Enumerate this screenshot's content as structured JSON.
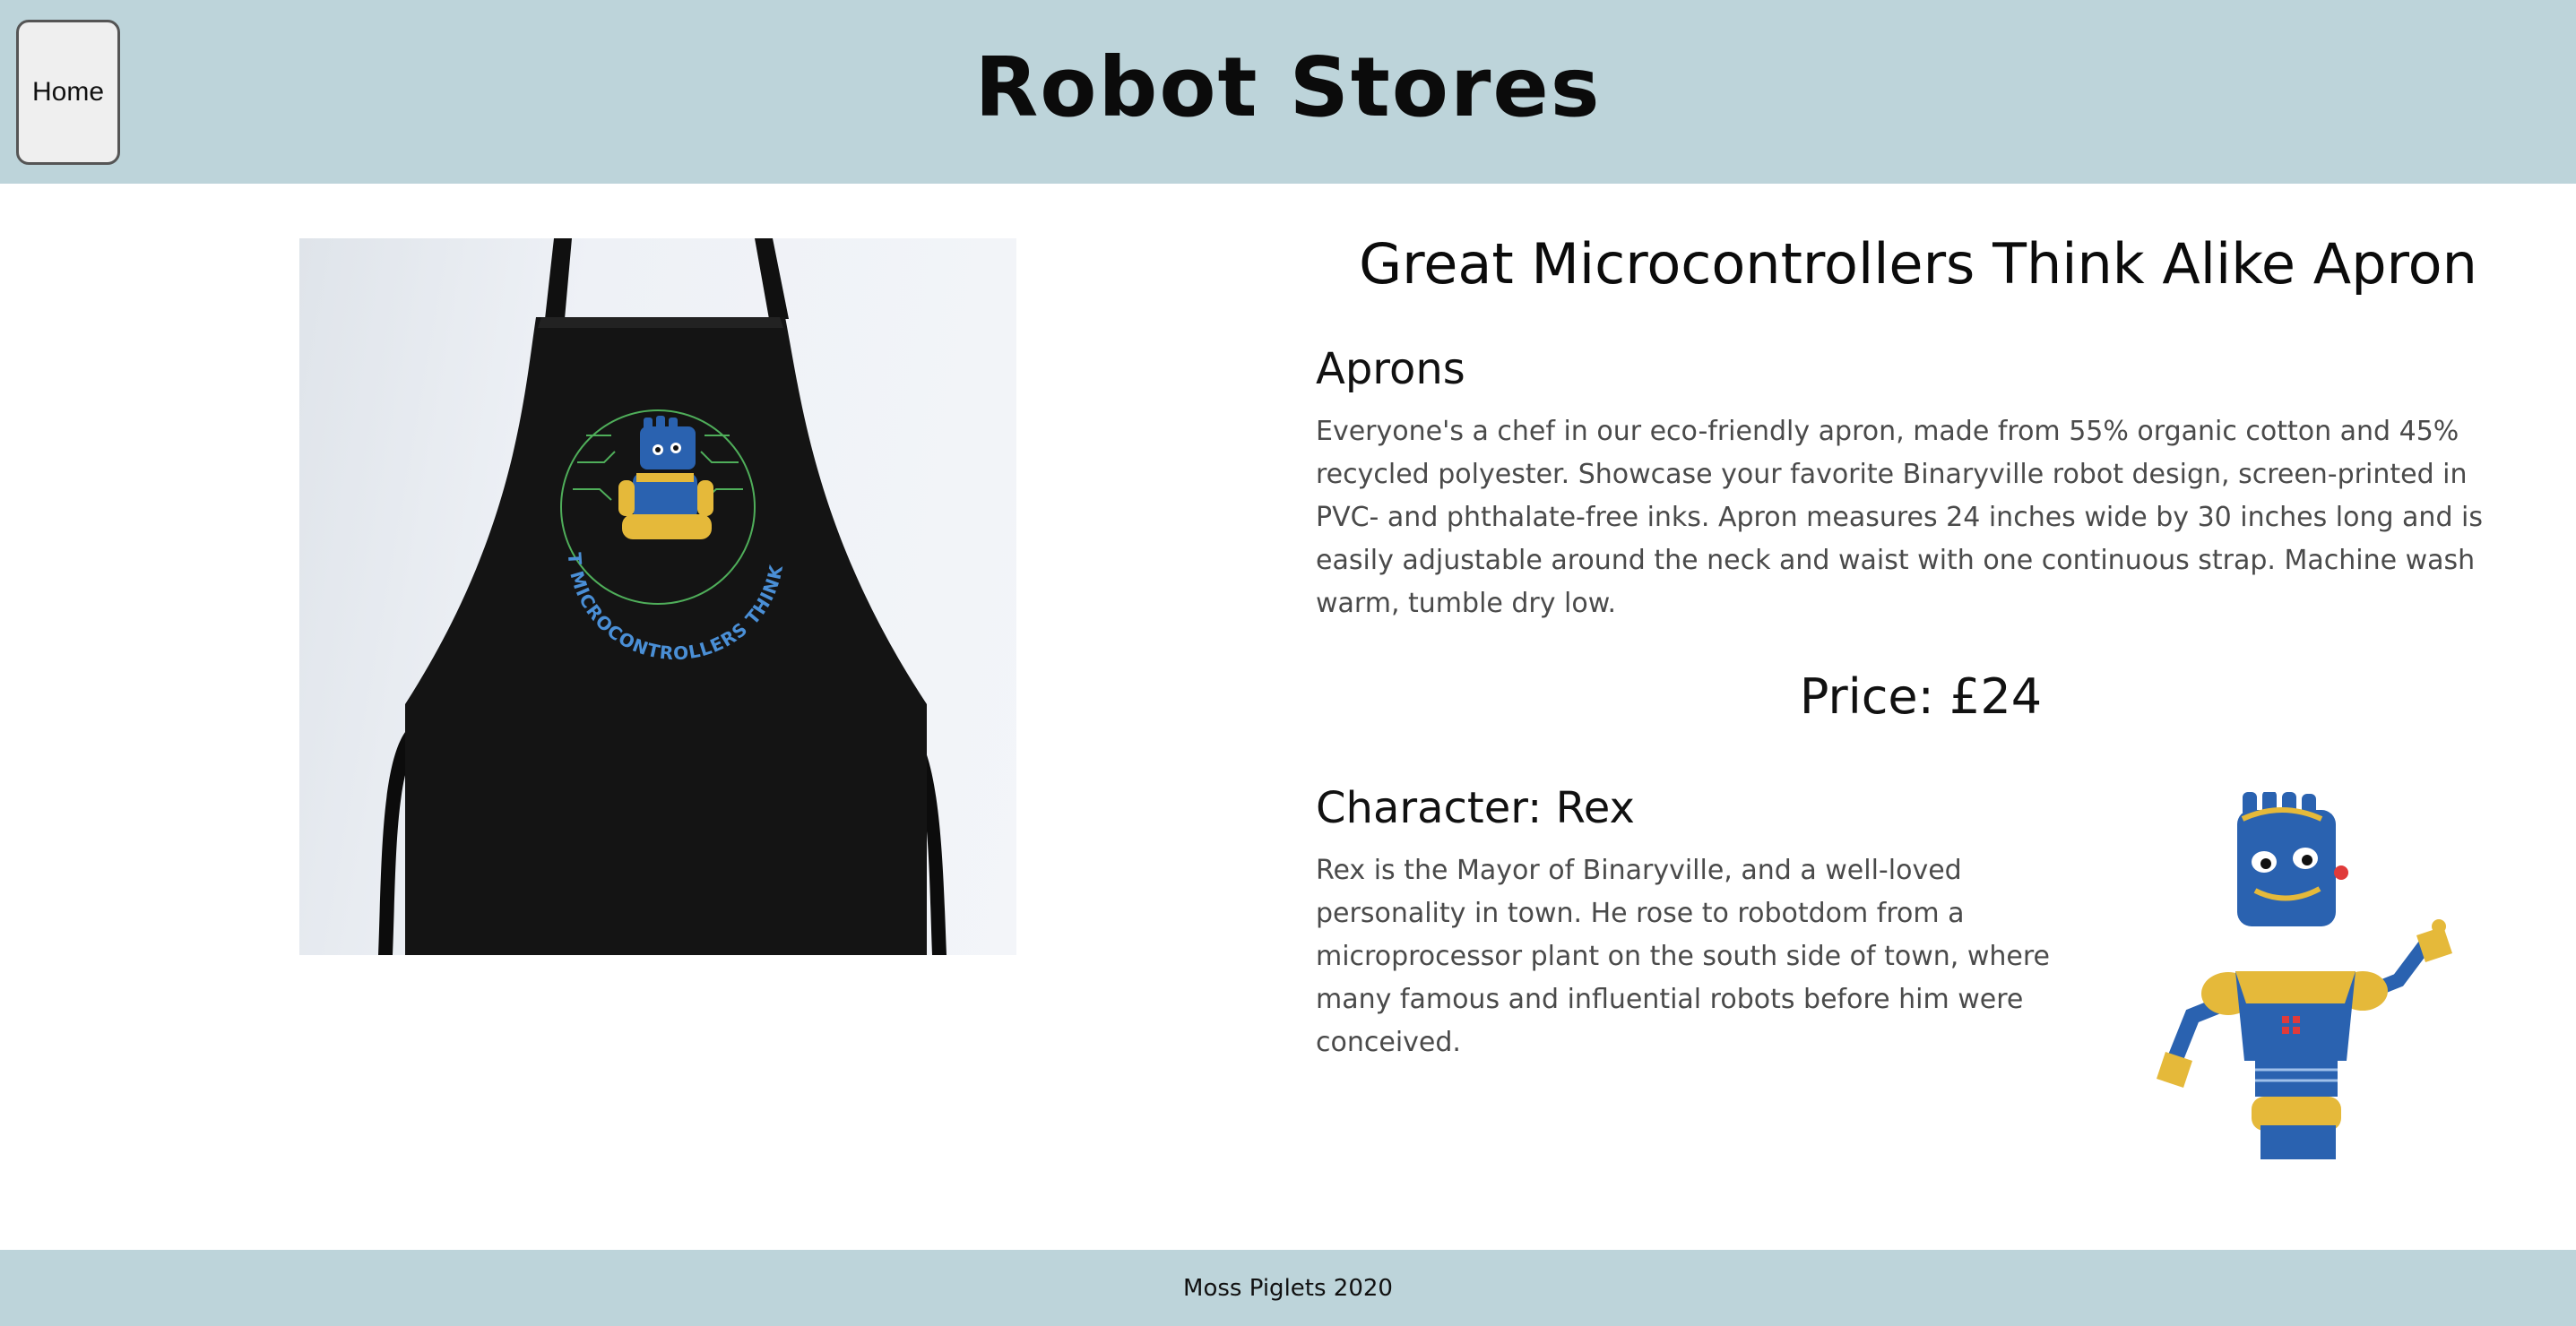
{
  "header": {
    "home_label": "Home",
    "site_title": "Robot Stores"
  },
  "product": {
    "title": "Great Microcontrollers Think Alike Apron",
    "category": "Aprons",
    "description": "Everyone's a chef in our eco-friendly apron, made from 55% organic cotton and 45% recycled polyester. Showcase your favorite Binaryville robot design, screen-printed in PVC- and phthalate-free inks. Apron measures 24 inches wide by 30 inches long and is easily adjustable around the neck and waist with one continuous strap. Machine wash warm, tumble dry low.",
    "price": "Price: £24",
    "apron_print_text": "GREAT MICROCONTROLLERS THINK ALIKE"
  },
  "character": {
    "heading": "Character: Rex",
    "bio": "Rex is the Mayor of Binaryville, and a well-loved personality in town. He rose to robotdom from a microprocessor plant on the south side of town, where many famous and influential robots before him were conceived."
  },
  "footer": {
    "text": "Moss Piglets 2020"
  },
  "colors": {
    "header_bg": "#bdd4da",
    "apron": "#141414",
    "robot_blue": "#2a62b0",
    "robot_yellow": "#e5b93a"
  }
}
